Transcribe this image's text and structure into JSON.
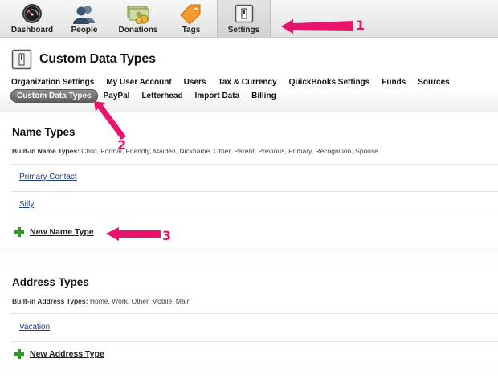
{
  "topnav": {
    "items": [
      {
        "label": "Dashboard",
        "icon": "dashboard-gauge-icon"
      },
      {
        "label": "People",
        "icon": "people-icon"
      },
      {
        "label": "Donations",
        "icon": "money-icon"
      },
      {
        "label": "Tags",
        "icon": "tag-icon"
      },
      {
        "label": "Settings",
        "icon": "settings-panel-icon",
        "active": true
      }
    ]
  },
  "header": {
    "title": "Custom Data Types",
    "icon": "settings-panel-icon"
  },
  "subnav": {
    "row1": [
      "Organization Settings",
      "My User Account",
      "Users",
      "Tax & Currency",
      "QuickBooks Settings",
      "Funds",
      "Sources"
    ],
    "row2": [
      "Custom Data Types",
      "PayPal",
      "Letterhead",
      "Import Data",
      "Billing"
    ],
    "active": "Custom Data Types"
  },
  "name_types": {
    "title": "Name Types",
    "builtin_label": "Built-in Name Types:",
    "builtin_values": "Child, Formal, Friendly, Maiden, Nickname, Other, Parent, Previous, Primary, Recognition, Spouse",
    "items": [
      "Primary Contact",
      "Silly"
    ],
    "new_label": "New Name Type"
  },
  "address_types": {
    "title": "Address Types",
    "builtin_label": "Built-in Address Types:",
    "builtin_values": "Home, Work, Other, Mobile, Main",
    "items": [
      "Vacation"
    ],
    "new_label": "New Address Type"
  },
  "annotations": {
    "labels": [
      "1",
      "2",
      "3"
    ],
    "color": "#e8136b"
  },
  "colors": {
    "link": "#1a3c8c",
    "plus": "#2e9a24",
    "pill": "#6e6e6e"
  }
}
